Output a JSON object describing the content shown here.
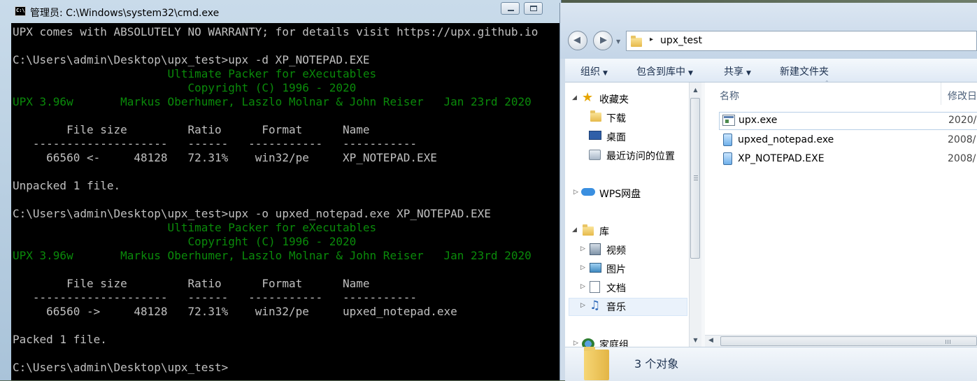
{
  "cmd": {
    "title": "管理员: C:\\Windows\\system32\\cmd.exe",
    "icon": "cmd-icon",
    "lines": [
      {
        "text": "UPX comes with ABSOLUTELY NO WARRANTY; for details visit https://upx.github.io",
        "color": "w"
      },
      {
        "text": "",
        "color": "w"
      },
      {
        "text": "C:\\Users\\admin\\Desktop\\upx_test>upx -d XP_NOTEPAD.EXE",
        "color": "w"
      },
      {
        "text": "                       Ultimate Packer for eXecutables",
        "color": "g2"
      },
      {
        "text": "                          Copyright (C) 1996 - 2020",
        "color": "g2"
      },
      {
        "text": "UPX 3.96w       Markus Oberhumer, Laszlo Molnar & John Reiser   Jan 23rd 2020",
        "color": "g2"
      },
      {
        "text": "",
        "color": "w"
      },
      {
        "text": "        File size         Ratio      Format      Name",
        "color": "w"
      },
      {
        "text": "   --------------------   ------   -----------   -----------",
        "color": "w"
      },
      {
        "text": "     66560 <-     48128   72.31%    win32/pe     XP_NOTEPAD.EXE",
        "color": "w"
      },
      {
        "text": "",
        "color": "w"
      },
      {
        "text": "Unpacked 1 file.",
        "color": "w"
      },
      {
        "text": "",
        "color": "w"
      },
      {
        "text": "C:\\Users\\admin\\Desktop\\upx_test>upx -o upxed_notepad.exe XP_NOTEPAD.EXE",
        "color": "w"
      },
      {
        "text": "                       Ultimate Packer for eXecutables",
        "color": "g2"
      },
      {
        "text": "                          Copyright (C) 1996 - 2020",
        "color": "g2"
      },
      {
        "text": "UPX 3.96w       Markus Oberhumer, Laszlo Molnar & John Reiser   Jan 23rd 2020",
        "color": "g2"
      },
      {
        "text": "",
        "color": "w"
      },
      {
        "text": "        File size         Ratio      Format      Name",
        "color": "w"
      },
      {
        "text": "   --------------------   ------   -----------   -----------",
        "color": "w"
      },
      {
        "text": "     66560 ->     48128   72.31%    win32/pe     upxed_notepad.exe",
        "color": "w"
      },
      {
        "text": "",
        "color": "w"
      },
      {
        "text": "Packed 1 file.",
        "color": "w"
      },
      {
        "text": "",
        "color": "w"
      },
      {
        "text": "C:\\Users\\admin\\Desktop\\upx_test>",
        "color": "w"
      }
    ]
  },
  "explorer": {
    "address": {
      "sep": "▸",
      "path": "upx_test"
    },
    "toolbar": [
      {
        "label": "组织",
        "name": "organize-button"
      },
      {
        "label": "包含到库中",
        "name": "include-in-library-button"
      },
      {
        "label": "共享",
        "name": "share-button"
      },
      {
        "label": "新建文件夹",
        "name": "new-folder-button"
      }
    ],
    "tree": {
      "favorites": "收藏夹",
      "downloads": "下载",
      "desktop": "桌面",
      "recent": "最近访问的位置",
      "wps": "WPS网盘",
      "library": "库",
      "videos": "视频",
      "pictures": "图片",
      "documents": "文档",
      "music": "音乐",
      "homegroup": "家庭组"
    },
    "columns": {
      "name": "名称",
      "modified": "修改日"
    },
    "files": [
      {
        "name": "upx.exe",
        "date": "2020/",
        "icon": "exe-icon"
      },
      {
        "name": "upxed_notepad.exe",
        "date": "2008/",
        "icon": "notepad-icon"
      },
      {
        "name": "XP_NOTEPAD.EXE",
        "date": "2008/",
        "icon": "notepad-icon"
      }
    ],
    "status": "3 个对象"
  },
  "colors": {
    "console_bg": "#000000",
    "console_text": "#c0c0c0",
    "console_green": "#0a8a0a"
  }
}
